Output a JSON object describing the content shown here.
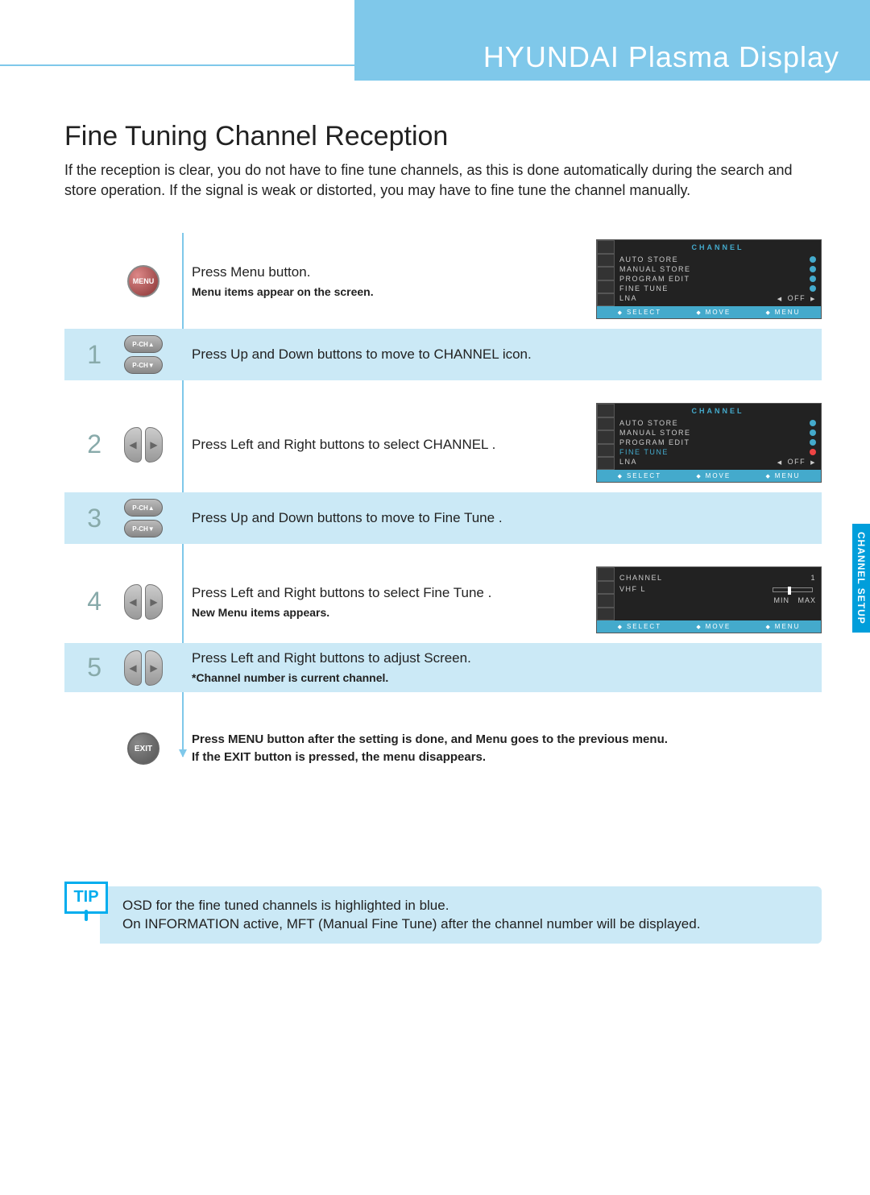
{
  "header": {
    "title": "HYUNDAI Plasma Display"
  },
  "page_title": "Fine Tuning Channel Reception",
  "intro": "If the reception is clear, you do not have to fine tune channels, as this is done automatically during the search and store operation. If the signal is weak or distorted, you may have to fine tune the channel manually.",
  "side_tab": "CHANNEL SETUP",
  "buttons": {
    "menu": "MENU",
    "pch_up": "P-CH▲",
    "pch_dn": "P-CH▼",
    "exit": "EXIT"
  },
  "steps": {
    "s0": {
      "text": "Press Menu button.",
      "sub": "Menu items appear on the screen."
    },
    "s1": {
      "num": "1",
      "text": "Press Up and Down buttons to move to  CHANNEL  icon."
    },
    "s2": {
      "num": "2",
      "text": "Press Left and Right buttons to select  CHANNEL ."
    },
    "s3": {
      "num": "3",
      "text": "Press Up and Down buttons to move to  Fine Tune ."
    },
    "s4": {
      "num": "4",
      "text": "Press Left and Right buttons to select  Fine Tune .",
      "sub": "New Menu items appears."
    },
    "s5": {
      "num": "5",
      "text": "Press Left and Right buttons to adjust Screen.",
      "sub": "*Channel number is current channel."
    }
  },
  "exit_note": {
    "l1": "Press MENU button after the setting is done, and Menu goes to the previous menu.",
    "l2": "If the EXIT button is pressed, the menu disappears."
  },
  "osd": {
    "title": "CHANNEL",
    "items": {
      "auto": "AUTO  STORE",
      "manual": "MANUAL  STORE",
      "program": "PROGRAM  EDIT",
      "fine": "FINE  TUNE",
      "lna": "LNA",
      "lna_val": "OFF"
    },
    "foot": {
      "select": "SELECT",
      "move": "MOVE",
      "menu": "MENU"
    },
    "fine_panel": {
      "channel_label": "CHANNEL",
      "channel_val": "1",
      "vhf": "VHF  L",
      "min": "MIN",
      "max": "MAX"
    }
  },
  "tip": {
    "badge": "TIP",
    "l1": "OSD for the fine tuned channels is highlighted in blue.",
    "l2": "On INFORMATION active, MFT  (Manual Fine Tune) after the channel number will be displayed."
  }
}
